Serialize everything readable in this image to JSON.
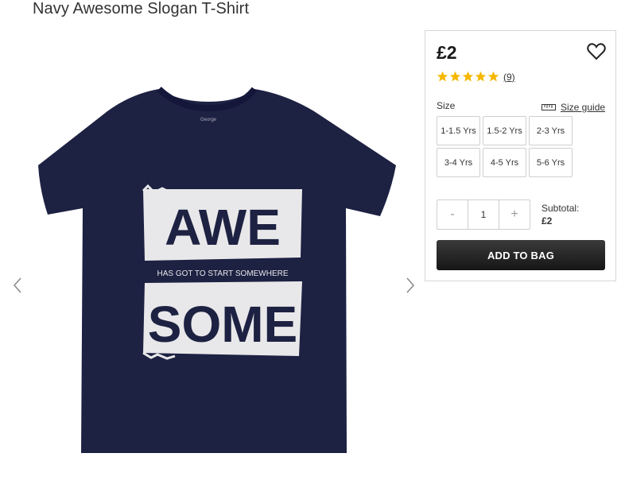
{
  "product": {
    "title": "Navy Awesome Slogan T-Shirt",
    "price": "£2",
    "rating": {
      "stars": 5,
      "max": 5,
      "count": "(9)"
    },
    "colors": {
      "shirt": "#1d2142",
      "print": "#e8e8ea",
      "star": "#f5b800"
    }
  },
  "gallery": {
    "print_text_top": "AWE",
    "print_text_middle": "HAS GOT TO START SOMEWHERE",
    "print_text_bottom": "SOME",
    "label_text": "George"
  },
  "sizes": {
    "label": "Size",
    "guide_label": "Size guide",
    "options": [
      "1-1.5 Yrs",
      "1.5-2 Yrs",
      "2-3 Yrs",
      "3-4 Yrs",
      "4-5 Yrs",
      "5-6 Yrs"
    ]
  },
  "quantity": {
    "minus": "-",
    "value": "1",
    "plus": "+"
  },
  "subtotal": {
    "label": "Subtotal:",
    "value": "£2"
  },
  "cta": {
    "add_to_bag": "ADD TO BAG"
  }
}
